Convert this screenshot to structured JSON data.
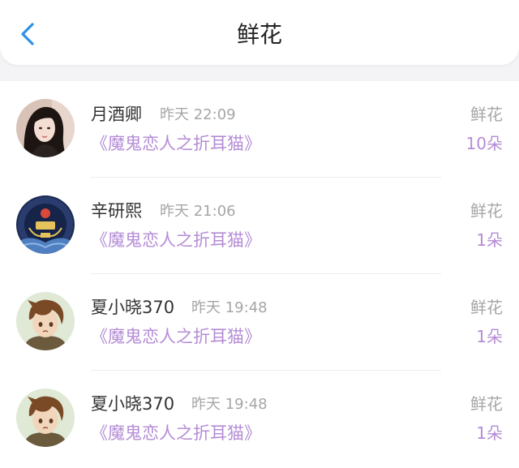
{
  "header": {
    "title": "鲜花",
    "back_icon": "chevron-left-icon",
    "accent_color": "#2e8fe6"
  },
  "colors": {
    "book_link": "#b48cd6",
    "meta_gray": "#a6a6a6"
  },
  "records": [
    {
      "name": "月酒卿",
      "time": "昨天 22:09",
      "book": "《魔鬼恋人之折耳猫》",
      "gift_type": "鲜花",
      "gift_count": "10朵",
      "avatar": "avatar-photo-woman"
    },
    {
      "name": "辛研熙",
      "time": "昨天 21:06",
      "book": "《魔鬼恋人之折耳猫》",
      "gift_type": "鲜花",
      "gift_count": "1朵",
      "avatar": "avatar-emblem"
    },
    {
      "name": "夏小晓370",
      "time": "昨天 19:48",
      "book": "《魔鬼恋人之折耳猫》",
      "gift_type": "鲜花",
      "gift_count": "1朵",
      "avatar": "avatar-anime-boy"
    },
    {
      "name": "夏小晓370",
      "time": "昨天 19:48",
      "book": "《魔鬼恋人之折耳猫》",
      "gift_type": "鲜花",
      "gift_count": "1朵",
      "avatar": "avatar-anime-boy"
    }
  ]
}
